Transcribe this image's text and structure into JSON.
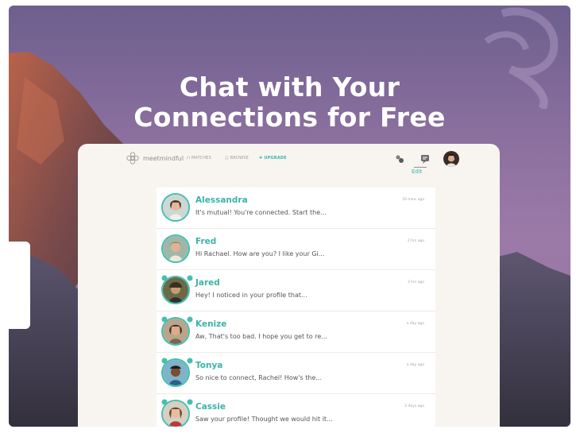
{
  "headline": {
    "line1": "Chat with Your",
    "line2": "Connections for Free"
  },
  "nav": {
    "brand": "meetmindful",
    "matches": "MATCHES",
    "browse": "BROWSE",
    "upgrade": "UPGRADE",
    "edit": "Edit"
  },
  "conversations": [
    {
      "name": "Alessandra",
      "message": "It's mutual! You're connected. Start the...",
      "time": "50 mins ago",
      "bubbles": false
    },
    {
      "name": "Fred",
      "message": "Hi Rachael. How are you? I like your Gi...",
      "time": "2 hrs ago",
      "bubbles": false
    },
    {
      "name": "Jared",
      "message": "Hey! I noticed in your profile that...",
      "time": "3 hrs ago",
      "bubbles": true
    },
    {
      "name": "Kenize",
      "message": "Aw, That's too bad. I hope you get to re...",
      "time": "a day ago",
      "bubbles": true
    },
    {
      "name": "Tonya",
      "message": "So nice to connect, Rachel! How's the...",
      "time": "a day ago",
      "bubbles": true
    },
    {
      "name": "Cassie",
      "message": "Saw your profile! Thought we would hit it...",
      "time": "2 days ago",
      "bubbles": true
    }
  ],
  "colors": {
    "accent": "#3bb3a6",
    "background_top": "#6d5f8e",
    "panel": "#f8f5f1"
  }
}
